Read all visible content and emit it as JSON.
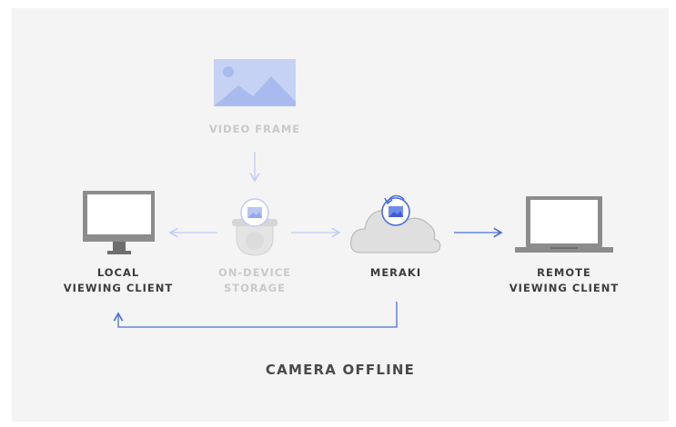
{
  "nodes": {
    "video_frame": {
      "label": "VIDEO FRAME"
    },
    "local_client": {
      "lines": [
        "LOCAL",
        "VIEWING CLIENT"
      ]
    },
    "on_device_storage": {
      "lines": [
        "ON-DEVICE",
        "STORAGE"
      ]
    },
    "meraki": {
      "label": "MERAKI"
    },
    "remote_client": {
      "lines": [
        "REMOTE",
        "VIEWING CLIENT"
      ]
    }
  },
  "caption": "CAMERA OFFLINE",
  "colors": {
    "panel": "#f4f4f4",
    "accent_blue": "#4a6fd8",
    "faded_blue": "#c2cdf2",
    "device_gray": "#8c8c8c",
    "faded_gray": "#dcdcdc",
    "label_dark": "#3c3c3c",
    "label_faded": "#c9c9c9"
  },
  "icons": [
    "image-icon",
    "monitor-icon",
    "camera-icon",
    "cloud-icon",
    "laptop-icon",
    "refresh-icon"
  ]
}
